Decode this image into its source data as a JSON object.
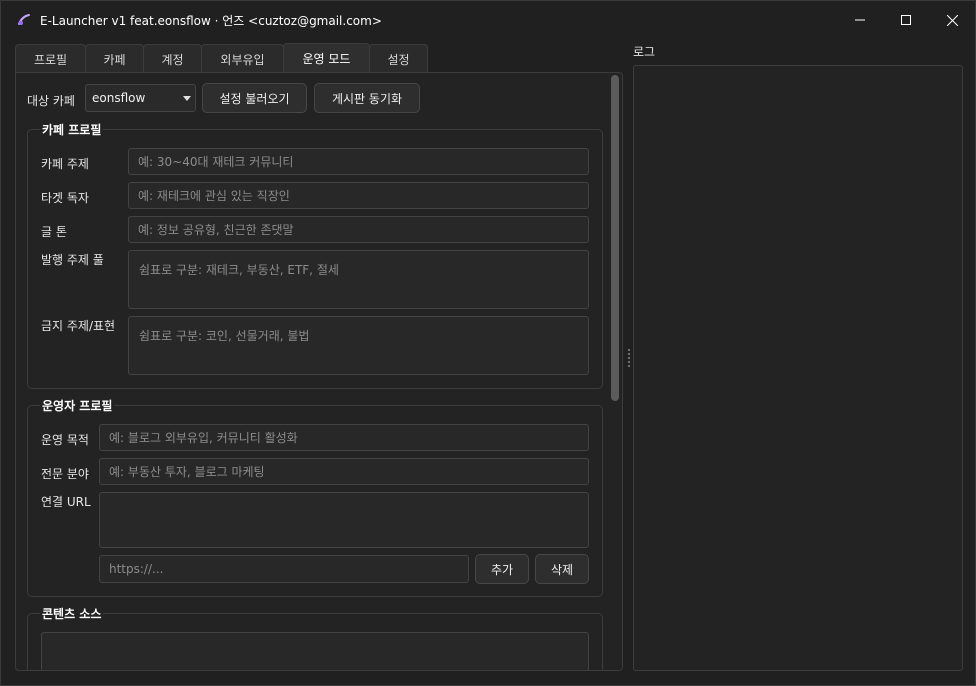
{
  "window": {
    "title": "E-Launcher v1 feat.eonsflow  ·  언즈 <cuztoz@gmail.com>",
    "minimize_icon": "minimize-icon",
    "maximize_icon": "maximize-icon",
    "close_icon": "close-icon"
  },
  "tabs": [
    {
      "label": "프로필",
      "active": false
    },
    {
      "label": "카페",
      "active": false
    },
    {
      "label": "계정",
      "active": false
    },
    {
      "label": "외부유입",
      "active": false
    },
    {
      "label": "운영 모드",
      "active": true
    },
    {
      "label": "설정",
      "active": false
    }
  ],
  "toprow": {
    "target_cafe_label": "대상 카페",
    "target_cafe_value": "eonsflow",
    "load_settings_label": "설정 불러오기",
    "sync_board_label": "게시판 동기화"
  },
  "cafe_profile": {
    "title": "카페 프로필",
    "topic_label": "카페 주제",
    "topic_placeholder": "예: 30~40대 재테크 커뮤니티",
    "target_label": "타겟 독자",
    "target_placeholder": "예: 재테크에 관심 있는 직장인",
    "tone_label": "글 톤",
    "tone_placeholder": "예: 정보 공유형, 친근한 존댓말",
    "pool_label": "발행 주제 풀",
    "pool_placeholder": "쉼표로 구분: 재테크, 부동산, ETF, 절세",
    "banned_label": "금지 주제/표현",
    "banned_placeholder": "쉼표로 구분: 코인, 선물거래, 불법"
  },
  "operator_profile": {
    "title": "운영자 프로필",
    "purpose_label": "운영 목적",
    "purpose_placeholder": "예: 블로그 외부유입, 커뮤니티 활성화",
    "expertise_label": "전문 분야",
    "expertise_placeholder": "예: 부동산 투자, 블로그 마케팅",
    "url_label": "연결 URL",
    "url_input_placeholder": "https://...",
    "add_label": "추가",
    "delete_label": "삭제"
  },
  "content_source": {
    "title": "콘텐츠 소스"
  },
  "log": {
    "title": "로그"
  }
}
